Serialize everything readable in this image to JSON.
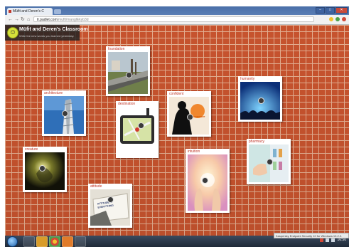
{
  "browser": {
    "tab_title": "Müfit and Deren's C",
    "url_domain": "tr.padlet.com",
    "url_path": "/mufit/manglEkyb3d"
  },
  "padlet": {
    "title": "Müfit and Deren's Classroom",
    "subtitle": "Write the new words you learned yesterday."
  },
  "cards": [
    {
      "label": "foundation"
    },
    {
      "label": "architecture"
    },
    {
      "label": "destination"
    },
    {
      "label": "confident"
    },
    {
      "label": "humanity"
    },
    {
      "label": "creature"
    },
    {
      "label": "attitude"
    },
    {
      "label": "intuition"
    },
    {
      "label": "pharmacy"
    }
  ],
  "image_text": {
    "confident": "CONFIDENT",
    "attitude": "ATTITUDE IS EVERYTHING"
  },
  "notice": "Kaspersky Endpoint Security 10 for Windows 10.2.2.",
  "taskbar": {
    "clock": "16:50"
  },
  "colors": {
    "brick": "#c6532e",
    "mortar": "#e2ad90",
    "label": "#c0392b"
  }
}
